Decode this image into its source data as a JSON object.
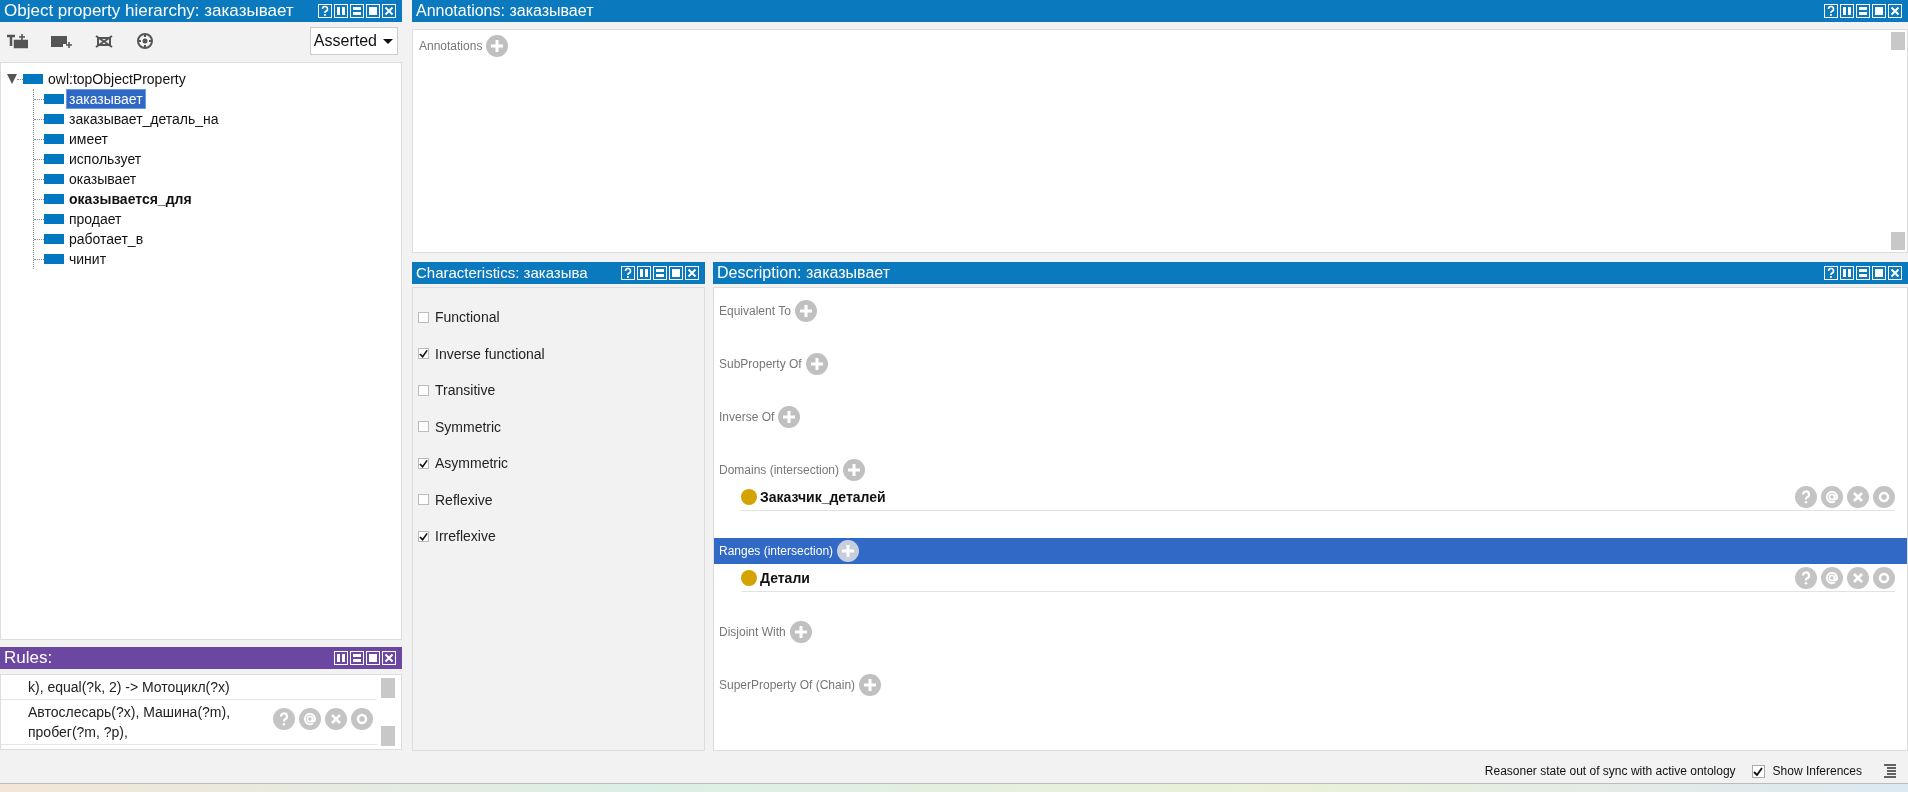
{
  "hierarchy": {
    "title": "Object property hierarchy: заказывает",
    "help": true,
    "view_dropdown": "Asserted",
    "tree": [
      {
        "label": "owl:topObjectProperty",
        "selected": false,
        "bold": false,
        "expanded": true,
        "children": [
          {
            "label": "заказывает",
            "selected": true,
            "bold": false
          },
          {
            "label": "заказывает_деталь_на",
            "selected": false,
            "bold": false
          },
          {
            "label": "имеет",
            "selected": false,
            "bold": false
          },
          {
            "label": "использует",
            "selected": false,
            "bold": false
          },
          {
            "label": "оказывает",
            "selected": false,
            "bold": false
          },
          {
            "label": "оказывается_для",
            "selected": false,
            "bold": true
          },
          {
            "label": "продает",
            "selected": false,
            "bold": false
          },
          {
            "label": "работает_в",
            "selected": false,
            "bold": false
          },
          {
            "label": "чинит",
            "selected": false,
            "bold": false
          }
        ]
      }
    ]
  },
  "rules": {
    "title": "Rules:",
    "help": false,
    "rows": [
      {
        "text": "k), equal(?k, 2) -> Мотоцикл(?x)",
        "buttons": false
      },
      {
        "text": "Автослесарь(?x), Машина(?m),\nпробег(?m, ?p),",
        "buttons": true
      }
    ]
  },
  "annotations": {
    "title": "Annotations: заказывает",
    "help": true,
    "section": "Annotations"
  },
  "characteristics": {
    "title": "Characteristics: заказыва",
    "help": true,
    "items": [
      {
        "label": "Functional",
        "checked": false
      },
      {
        "label": "Inverse functional",
        "checked": true
      },
      {
        "label": "Transitive",
        "checked": false
      },
      {
        "label": "Symmetric",
        "checked": false
      },
      {
        "label": "Asymmetric",
        "checked": true
      },
      {
        "label": "Reflexive",
        "checked": false
      },
      {
        "label": "Irreflexive",
        "checked": true
      }
    ]
  },
  "description": {
    "title": "Description: заказывает",
    "help": true,
    "sections": [
      {
        "label": "Equivalent To",
        "selected": false
      },
      {
        "label": "SubProperty Of",
        "selected": false
      },
      {
        "label": "Inverse Of",
        "selected": false
      },
      {
        "label": "Domains (intersection)",
        "selected": false,
        "items": [
          {
            "label": "Заказчик_деталей",
            "color": "#d4a300"
          }
        ]
      },
      {
        "label": "Ranges (intersection)",
        "selected": true,
        "items": [
          {
            "label": "Детали",
            "color": "#d4a300"
          }
        ]
      },
      {
        "label": "Disjoint With",
        "selected": false
      },
      {
        "label": "SuperProperty Of (Chain)",
        "selected": false
      }
    ]
  },
  "status_bar": {
    "message": "Reasoner state out of sync with active ontology",
    "show_inferences": {
      "label": "Show Inferences",
      "checked": true
    }
  }
}
